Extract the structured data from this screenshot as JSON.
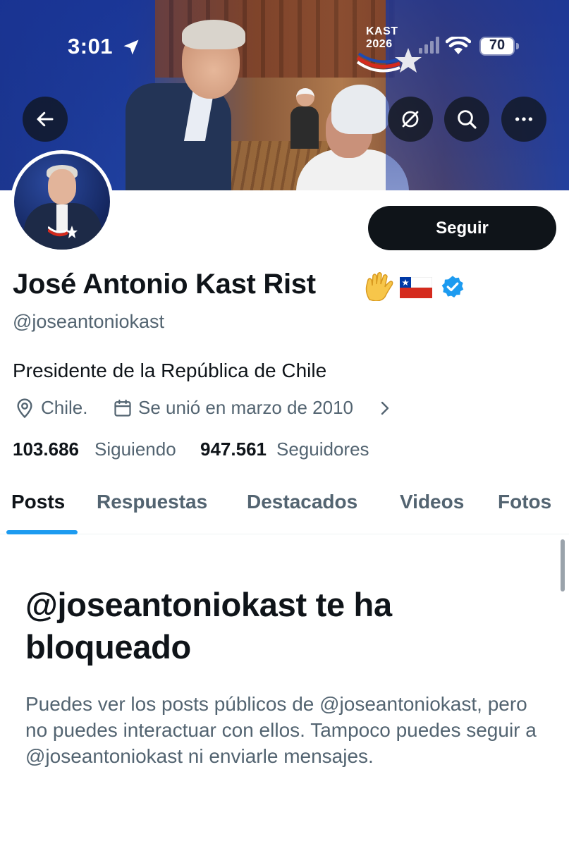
{
  "status_bar": {
    "time": "3:01",
    "battery_level": "70",
    "icons": [
      "location-arrow-icon",
      "cellular-signal-icon",
      "wifi-icon",
      "battery-icon"
    ]
  },
  "banner": {
    "logo_line1": "KAST",
    "logo_line2": "2026"
  },
  "header_actions": {
    "icons": [
      "back-arrow-icon",
      "grok-icon",
      "search-icon",
      "more-icon"
    ]
  },
  "profile": {
    "display_name": "José Antonio Kast Rist",
    "name_emoji": "🖐",
    "flag_emoji": "🇨🇱",
    "handle": "@joseantoniokast",
    "bio": "Presidente de la República de Chile",
    "location": "Chile.",
    "joined": "Se unió en marzo de 2010",
    "following_count": "103.686",
    "following_label": "Siguiendo",
    "followers_count": "947.561",
    "followers_label": "Seguidores"
  },
  "follow_button": {
    "label": "Seguir"
  },
  "tabs": [
    {
      "label": "Posts",
      "active": true
    },
    {
      "label": "Respuestas",
      "active": false
    },
    {
      "label": "Destacados",
      "active": false
    },
    {
      "label": "Videos",
      "active": false
    },
    {
      "label": "Fotos",
      "active": false
    }
  ],
  "blocked_notice": {
    "title": "@joseantoniokast te ha bloqueado",
    "description": "Puedes ver los posts públicos de @joseantoniokast, pero no puedes interactuar con ellos. Tampoco puedes seguir a @joseantoniokast ni enviarle mensajes."
  },
  "colors": {
    "accent": "#1d9bf0",
    "text_primary": "#0f1419",
    "text_secondary": "#536471",
    "button_dark": "#0f1419",
    "verified": "#1d9bf0"
  }
}
